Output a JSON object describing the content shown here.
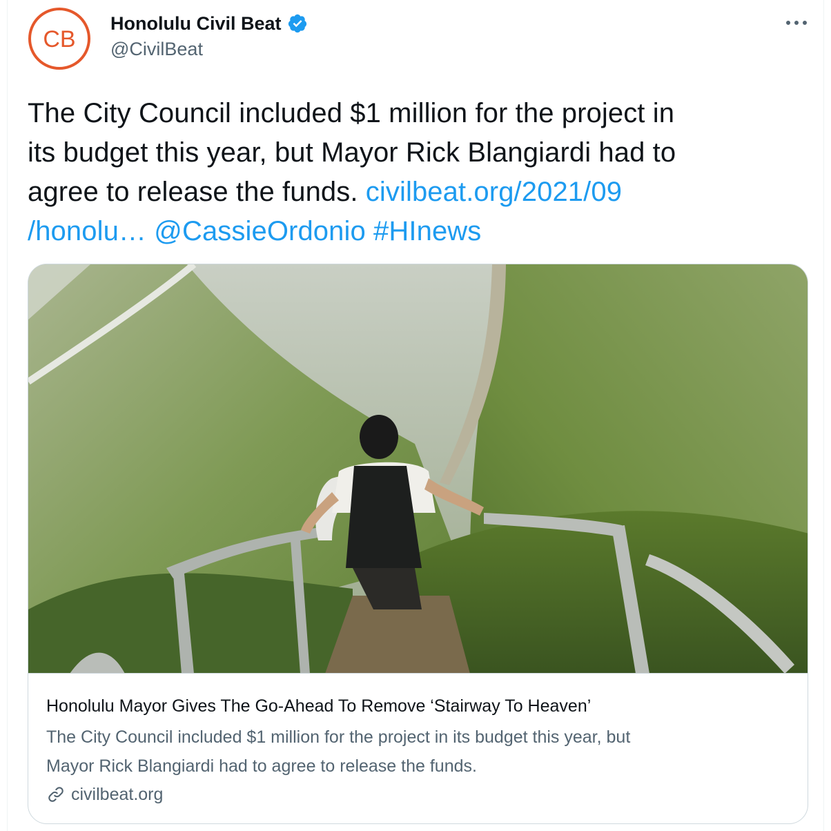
{
  "author": {
    "avatar_initials": "CB",
    "display_name": "Honolulu Civil Beat",
    "handle": "@CivilBeat",
    "verified_icon": "verified-badge-icon",
    "brand_color": "#e5582b"
  },
  "more_icon": "more-options-icon",
  "tweet": {
    "line1": "The City Council included $1 million for the project in",
    "line2": "its budget this year, but Mayor Rick Blangiardi had to",
    "line3_text": "agree to release the funds. ",
    "line3_link": "civilbeat.org/2021/09",
    "line4_link": "/honolu…",
    "mention": "@CassieOrdonio",
    "hashtag": "#HInews",
    "link_color": "#1d9bf0"
  },
  "card": {
    "title": "Honolulu Mayor Gives The Go-Ahead To Remove ‘Stairway To Heaven’",
    "description_line1": "The City Council included $1 million for the project in its budget this year, but",
    "description_line2": "Mayor Rick Blangiardi had to agree to release the funds.",
    "domain": "civilbeat.org",
    "domain_icon": "link-icon"
  }
}
